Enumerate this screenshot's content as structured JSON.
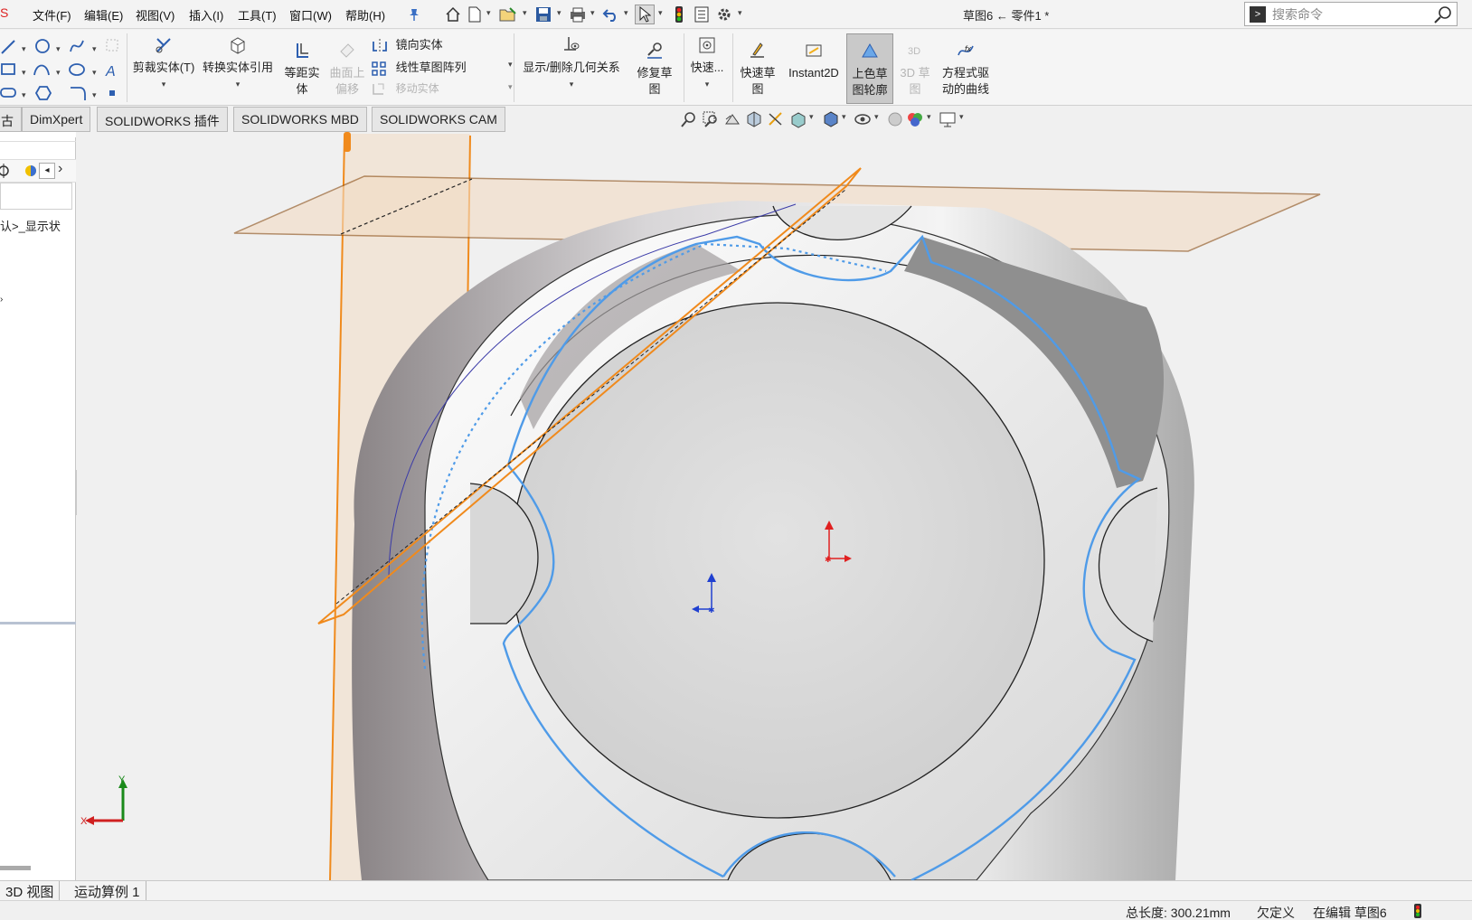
{
  "menubar": {
    "logo_fragment": "S",
    "menus": [
      "文件(F)",
      "编辑(E)",
      "视图(V)",
      "插入(I)",
      "工具(T)",
      "窗口(W)",
      "帮助(H)"
    ],
    "title": "草图6 ← 零件1 *",
    "search": {
      "placeholder": "搜索命令"
    }
  },
  "ribbon": {
    "trim": "剪裁实体(T)",
    "convert": "转换实体引用",
    "offset_line1": "等距实",
    "offset_line2": "体",
    "surface_offset_line1": "曲面上",
    "surface_offset_line2": "偏移",
    "mirror": "镜向实体",
    "linear_pattern": "线性草图阵列",
    "move": "移动实体",
    "display_relations": "显示/删除几何关系",
    "repair_line1": "修复草",
    "repair_line2": "图",
    "quick_snaps": "快速...",
    "rapid_sketch_line1": "快速草",
    "rapid_sketch_line2": "图",
    "instant2d": "Instant2D",
    "shaded_line1": "上色草",
    "shaded_line2": "图轮廓",
    "sketch3d_line1": "3D 草",
    "sketch3d_line2": "图",
    "equation_line1": "方程式驱",
    "equation_line2": "动的曲线"
  },
  "tabs": [
    "古",
    "DimXpert",
    "SOLIDWORKS 插件",
    "SOLIDWORKS MBD",
    "SOLIDWORKS CAM"
  ],
  "left_panel": {
    "tree_text": "认>_显示状"
  },
  "bottom_tabs": [
    "3D 视图",
    "运动算例 1"
  ],
  "status": {
    "total_length": "总长度: 300.21mm",
    "definition": "欠定义",
    "editing": "在编辑 草图6"
  },
  "colors": {
    "plane": "#f2dcc4",
    "plane_edge": "#8a4b10",
    "sketch_blue": "#4f9be8",
    "orange": "#f08a1c",
    "part": "#dcdcdc"
  },
  "triad": {
    "y": "Y",
    "x": "X"
  }
}
